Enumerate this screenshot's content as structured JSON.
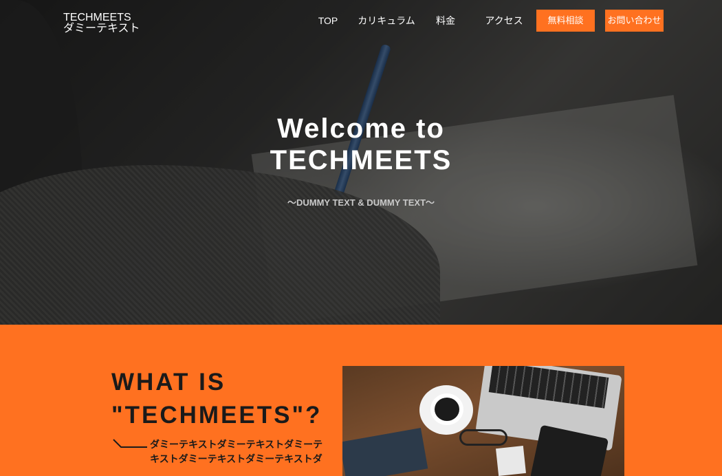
{
  "header": {
    "logo_line1": "TECHMEETS",
    "logo_line2": "ダミーテキスト",
    "nav": {
      "top": "TOP",
      "curriculum": "カリキュラム",
      "price": "料金",
      "access": "アクセス",
      "consult": "無料相談",
      "contact": "お問い合わせ"
    }
  },
  "hero": {
    "title_line1": "Welcome to",
    "title_line2": "TECHMEETS",
    "subtitle": "〜DUMMY TEXT & DUMMY TEXT〜"
  },
  "about": {
    "title_line1": "WHAT IS",
    "title_line2": "\"TECHMEETS\"?",
    "text": "ダミーテキストダミーテキストダミーテキストダミーテキストダミーテキストダ"
  },
  "colors": {
    "accent": "#ff7120",
    "text_dark": "#1a1a1a",
    "white": "#ffffff"
  }
}
